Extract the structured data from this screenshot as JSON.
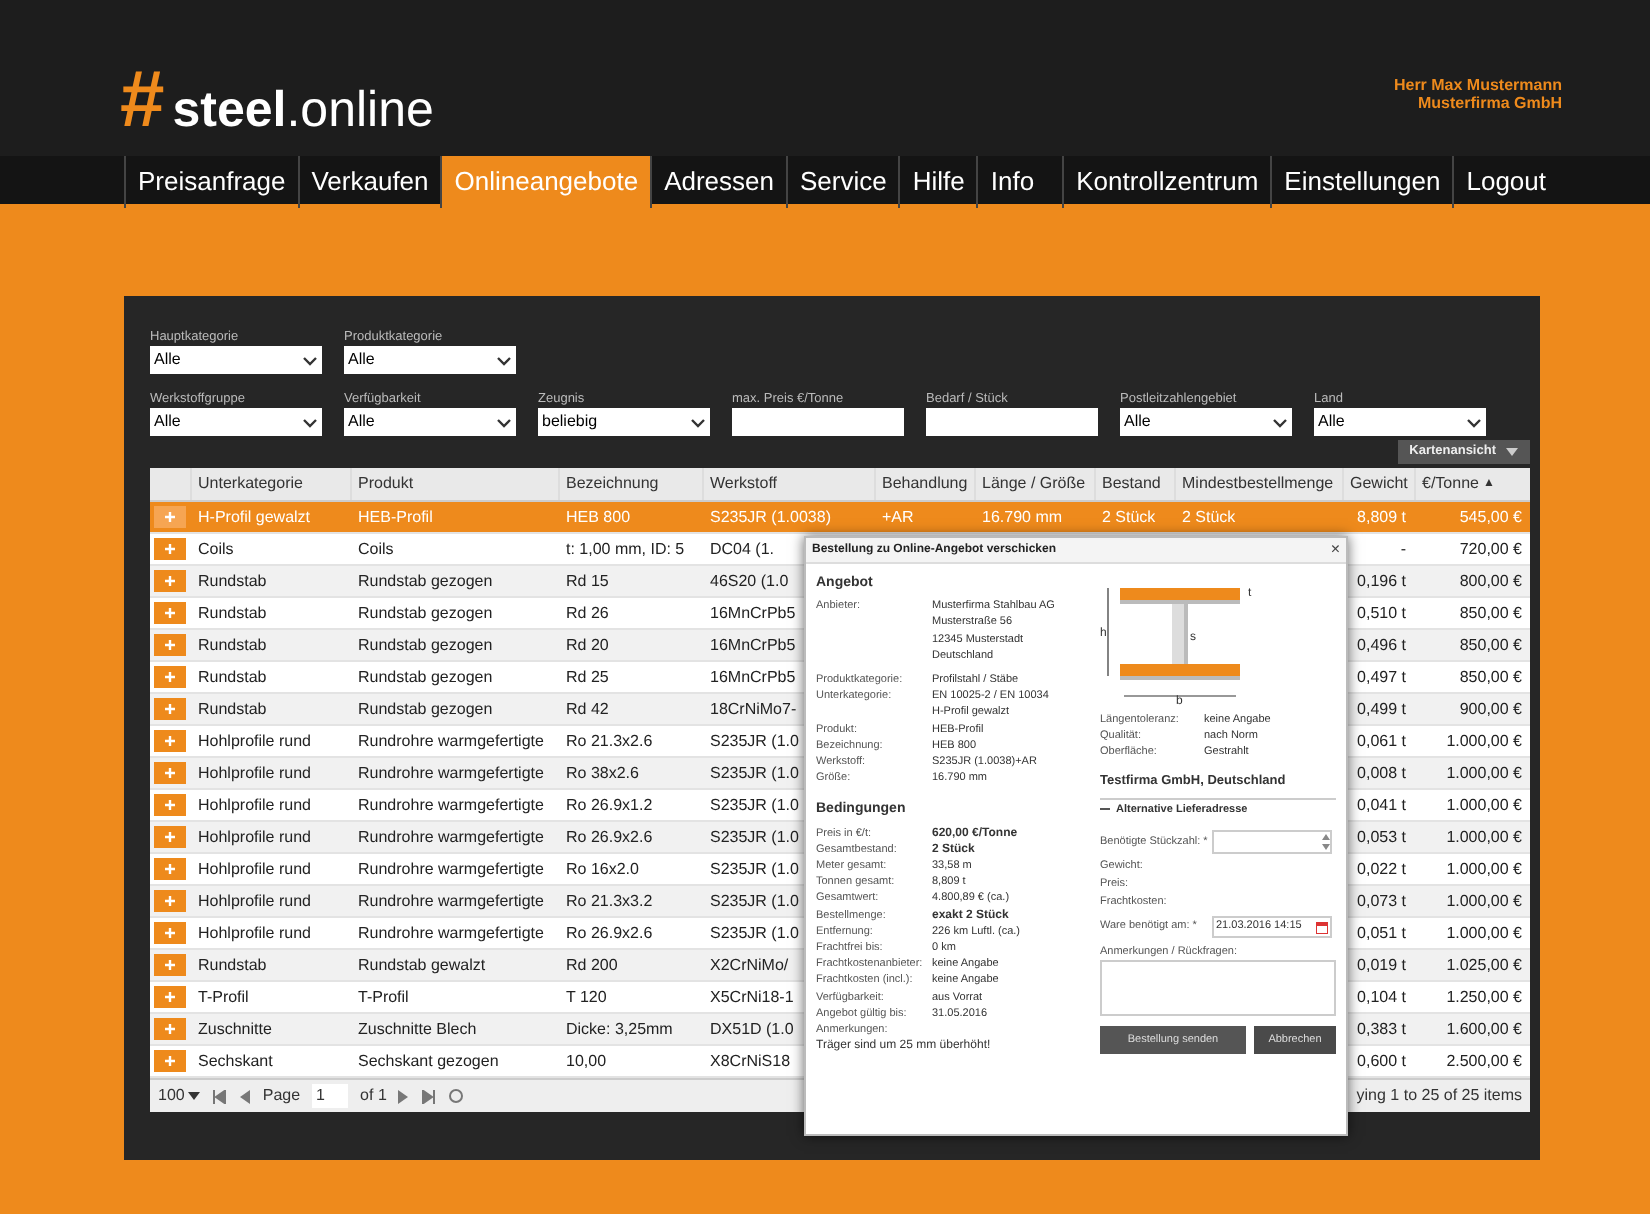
{
  "header": {
    "logo_mark": "#",
    "logo_bold": "steel",
    "logo_light": ".online",
    "user_name": "Herr Max Mustermann",
    "company": "Musterfirma GmbH"
  },
  "nav": {
    "left": [
      {
        "label": "Preisanfrage",
        "selected": false
      },
      {
        "label": "Verkaufen",
        "selected": false
      },
      {
        "label": "Onlineangebote",
        "selected": true
      },
      {
        "label": "Adressen",
        "selected": false
      },
      {
        "label": "Service",
        "selected": false
      },
      {
        "label": "Hilfe",
        "selected": false
      },
      {
        "label": "Info",
        "selected": false
      }
    ],
    "right": [
      {
        "label": "Kontrollzentrum",
        "selected": false
      },
      {
        "label": "Einstellungen",
        "selected": false
      },
      {
        "label": "Logout",
        "selected": false
      }
    ]
  },
  "filters": [
    [
      {
        "label": "Hauptkategorie",
        "value": "Alle",
        "kind": "select"
      },
      {
        "label": "Produktkategorie",
        "value": "Alle",
        "kind": "select"
      }
    ],
    [
      {
        "label": "Werkstoffgruppe",
        "value": "Alle",
        "kind": "select"
      },
      {
        "label": "Verfügbarkeit",
        "value": "Alle",
        "kind": "select"
      },
      {
        "label": "Zeugnis",
        "value": "beliebig",
        "kind": "select"
      },
      {
        "label": "max. Preis €/Tonne",
        "kind": "text"
      },
      {
        "label": "Bedarf / Stück",
        "kind": "text"
      },
      {
        "label": "Postleitzahlengebiet",
        "value": "Alle",
        "kind": "select"
      },
      {
        "label": "Land",
        "value": "Alle",
        "kind": "select"
      }
    ]
  ],
  "map_button": "Kartenansicht",
  "table": {
    "columns": [
      {
        "label": "Unterkategorie"
      },
      {
        "label": "Produkt"
      },
      {
        "label": "Bezeichnung"
      },
      {
        "label": "Werkstoff"
      },
      {
        "label": "Behandlung"
      },
      {
        "label": "Länge / Größe"
      },
      {
        "label": "Bestand"
      },
      {
        "label": "Mindestbestellmenge"
      },
      {
        "label": "Gewicht"
      },
      {
        "label": "€/Tonne",
        "sort": "▲"
      }
    ],
    "rows": [
      {
        "selected": true,
        "cells": [
          "H-Profil gewalzt",
          "HEB-Profil",
          "HEB 800",
          "S235JR (1.0038)",
          "+AR",
          "16.790 mm",
          "2 Stück",
          "2 Stück",
          "8,809 t",
          "545,00 €"
        ]
      },
      {
        "selected": false,
        "cells": [
          "Coils",
          "Coils",
          "t: 1,00 mm, ID: 5",
          "DC04 (1.",
          null,
          null,
          null,
          null,
          "-",
          "720,00 €"
        ]
      },
      {
        "selected": false,
        "cells": [
          "Rundstab",
          "Rundstab gezogen",
          "Rd 15",
          "46S20 (1.0",
          null,
          null,
          null,
          null,
          "0,196 t",
          "800,00 €"
        ]
      },
      {
        "selected": false,
        "cells": [
          "Rundstab",
          "Rundstab gezogen",
          "Rd 26",
          "16MnCrPb5",
          null,
          null,
          null,
          null,
          "0,510 t",
          "850,00 €"
        ]
      },
      {
        "selected": false,
        "cells": [
          "Rundstab",
          "Rundstab gezogen",
          "Rd 20",
          "16MnCrPb5",
          null,
          null,
          null,
          null,
          "0,496 t",
          "850,00 €"
        ]
      },
      {
        "selected": false,
        "cells": [
          "Rundstab",
          "Rundstab gezogen",
          "Rd 25",
          "16MnCrPb5",
          null,
          null,
          null,
          null,
          "0,497 t",
          "850,00 €"
        ]
      },
      {
        "selected": false,
        "cells": [
          "Rundstab",
          "Rundstab gezogen",
          "Rd 42",
          "18CrNiMo7-",
          null,
          null,
          null,
          null,
          "0,499 t",
          "900,00 €"
        ]
      },
      {
        "selected": false,
        "cells": [
          "Hohlprofile rund",
          "Rundrohre warmgefertigte",
          "Ro 21.3x2.6",
          "S235JR (1.0",
          null,
          null,
          null,
          null,
          "0,061 t",
          "1.000,00 €"
        ]
      },
      {
        "selected": false,
        "cells": [
          "Hohlprofile rund",
          "Rundrohre warmgefertigte",
          "Ro 38x2.6",
          "S235JR (1.0",
          null,
          null,
          null,
          null,
          "0,008 t",
          "1.000,00 €"
        ]
      },
      {
        "selected": false,
        "cells": [
          "Hohlprofile rund",
          "Rundrohre warmgefertigte",
          "Ro 26.9x1.2",
          "S235JR (1.0",
          null,
          null,
          null,
          null,
          "0,041 t",
          "1.000,00 €"
        ]
      },
      {
        "selected": false,
        "cells": [
          "Hohlprofile rund",
          "Rundrohre warmgefertigte",
          "Ro 26.9x2.6",
          "S235JR (1.0",
          null,
          null,
          null,
          null,
          "0,053 t",
          "1.000,00 €"
        ]
      },
      {
        "selected": false,
        "cells": [
          "Hohlprofile rund",
          "Rundrohre warmgefertigte",
          "Ro 16x2.0",
          "S235JR (1.0",
          null,
          null,
          null,
          null,
          "0,022 t",
          "1.000,00 €"
        ]
      },
      {
        "selected": false,
        "cells": [
          "Hohlprofile rund",
          "Rundrohre warmgefertigte",
          "Ro 21.3x3.2",
          "S235JR (1.0",
          null,
          null,
          null,
          null,
          "0,073 t",
          "1.000,00 €"
        ]
      },
      {
        "selected": false,
        "cells": [
          "Hohlprofile rund",
          "Rundrohre warmgefertigte",
          "Ro 26.9x2.6",
          "S235JR (1.0",
          null,
          null,
          null,
          null,
          "0,051 t",
          "1.000,00 €"
        ]
      },
      {
        "selected": false,
        "cells": [
          "Rundstab",
          "Rundstab gewalzt",
          "Rd 200",
          "X2CrNiMo/",
          null,
          null,
          null,
          null,
          "0,019 t",
          "1.025,00 €"
        ]
      },
      {
        "selected": false,
        "cells": [
          "T-Profil",
          "T-Profil",
          "T 120",
          "X5CrNi18-1",
          null,
          null,
          null,
          null,
          "0,104 t",
          "1.250,00 €"
        ]
      },
      {
        "selected": false,
        "cells": [
          "Zuschnitte",
          "Zuschnitte Blech",
          "Dicke: 3,25mm",
          "DX51D (1.0",
          null,
          null,
          null,
          null,
          "0,383 t",
          "1.600,00 €"
        ]
      },
      {
        "selected": false,
        "cells": [
          "Sechskant",
          "Sechskant gezogen",
          "10,00",
          "X8CrNiS18",
          null,
          null,
          null,
          null,
          "0,600 t",
          "2.500,00 €"
        ]
      }
    ]
  },
  "pager": {
    "page_size": "100",
    "page_label": "Page",
    "page": "1",
    "of": "of 1",
    "summary": "ying 1 to 25 of 25 items"
  },
  "dialog": {
    "title": "Bestellung zu Online-Angebot verschicken",
    "close": "×",
    "offer_heading": "Angebot",
    "offer": [
      {
        "label": "Anbieter:",
        "value": [
          "Musterfirma Stahlbau AG",
          "Musterstraße 56",
          "12345 Musterstadt",
          "Deutschland"
        ]
      },
      {
        "label": "Produktkategorie:",
        "value": [
          "Profilstahl / Stäbe"
        ]
      },
      {
        "label": "Unterkategorie:",
        "value": [
          "EN 10025-2 / EN 10034",
          "H-Profil gewalzt"
        ]
      },
      {
        "label": "Produkt:",
        "value": [
          "HEB-Profil"
        ]
      },
      {
        "label": "Bezeichnung:",
        "value": [
          "HEB 800"
        ]
      },
      {
        "label": "Werkstoff:",
        "value": [
          "S235JR (1.0038)+AR"
        ]
      },
      {
        "label": "Größe:",
        "value": [
          "16.790 mm"
        ]
      }
    ],
    "terms_heading": "Bedingungen",
    "terms": [
      {
        "label": "Preis in €/t:",
        "value": "620,00 €/Tonne",
        "bold": true
      },
      {
        "label": "Gesamtbestand:",
        "value": "2 Stück",
        "bold": true
      },
      {
        "label": "Meter gesamt:",
        "value": "33,58 m",
        "bold": false
      },
      {
        "label": "Tonnen gesamt:",
        "value": "8,809 t",
        "bold": false
      },
      {
        "label": "Gesamtwert:",
        "value": "4.800,89 € (ca.)",
        "bold": false
      },
      {
        "label": "Bestellmenge:",
        "value": "exakt 2 Stück",
        "bold": true
      },
      {
        "label": "Entfernung:",
        "value": "226 km Luftl. (ca.)",
        "bold": false
      },
      {
        "label": "Frachtfrei bis:",
        "value": "0 km",
        "bold": false
      },
      {
        "label": "Frachtkostenanbieter:",
        "value": "keine Angabe",
        "bold": false
      },
      {
        "label": "Frachtkosten (incl.):",
        "value": "keine Angabe",
        "bold": false
      },
      {
        "label": "Verfügbarkeit:",
        "value": "aus Vorrat",
        "bold": false
      },
      {
        "label": "Angebot gültig bis:",
        "value": "31.05.2016",
        "bold": false
      }
    ],
    "remarks_label": "Anmerkungen:",
    "remarks": "Träger sind um 25 mm überhöht!",
    "beam_labels": {
      "flange": "t",
      "height": "h",
      "web": "s",
      "width": "b"
    },
    "details": [
      {
        "label": "Längentoleranz:",
        "value": "keine Angabe"
      },
      {
        "label": "Qualität:",
        "value": "nach Norm"
      },
      {
        "label": "Oberfläche:",
        "value": "Gestrahlt"
      }
    ],
    "buyer": "Testfirma GmbH, Deutschland",
    "alt_address": "Alternative Lieferadresse",
    "form": [
      {
        "label": "Benötigte Stückzahl: *",
        "kind": "number"
      },
      {
        "label": "Gewicht:",
        "kind": "info"
      },
      {
        "label": "Preis:",
        "kind": "info"
      },
      {
        "label": "Frachtkosten:",
        "kind": "info"
      },
      {
        "label": "Ware benötigt am: *",
        "kind": "date",
        "value": "21.03.2016 14:15"
      }
    ],
    "notes_label": "Anmerkungen / Rückfragen:",
    "buttons": [
      {
        "label": "Bestellung senden",
        "kind": "primary"
      },
      {
        "label": "Abbrechen",
        "kind": "cancel"
      }
    ]
  }
}
